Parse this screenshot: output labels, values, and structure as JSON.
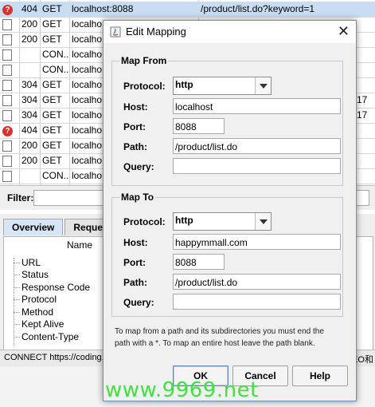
{
  "table": {
    "rows": [
      {
        "icon": "error-icon",
        "code": "404",
        "method": "GET",
        "host": "localhost:8088",
        "path": "/product/list.do?keyword=1",
        "extra": ""
      },
      {
        "icon": "document-icon",
        "code": "200",
        "method": "GET",
        "host": "localho",
        "path": "",
        "extra": ""
      },
      {
        "icon": "document-icon",
        "code": "200",
        "method": "GET",
        "host": "localho",
        "path": "",
        "extra": ""
      },
      {
        "icon": "document-icon",
        "code": "",
        "method": "CON...",
        "host": "localho",
        "path": "",
        "extra": ""
      },
      {
        "icon": "document-icon",
        "code": "",
        "method": "CON...",
        "host": "localho",
        "path": "",
        "extra": ""
      },
      {
        "icon": "document-stack-icon",
        "code": "304",
        "method": "GET",
        "host": "localho",
        "path": "",
        "extra": ""
      },
      {
        "icon": "document-stack-icon",
        "code": "304",
        "method": "GET",
        "host": "localho",
        "path": "",
        "extra": "17"
      },
      {
        "icon": "document-stack-icon",
        "code": "304",
        "method": "GET",
        "host": "localho",
        "path": "",
        "extra": "17"
      },
      {
        "icon": "error-icon",
        "code": "404",
        "method": "GET",
        "host": "localho",
        "path": "",
        "extra": ""
      },
      {
        "icon": "document-icon",
        "code": "200",
        "method": "GET",
        "host": "localho",
        "path": "",
        "extra": ""
      },
      {
        "icon": "document-icon",
        "code": "200",
        "method": "GET",
        "host": "localho",
        "path": "",
        "extra": ""
      },
      {
        "icon": "document-icon",
        "code": "",
        "method": "CON...",
        "host": "localho",
        "path": "",
        "extra": ""
      }
    ]
  },
  "filter": {
    "label": "Filter:"
  },
  "detail": {
    "tabs": [
      "Overview",
      "Request"
    ],
    "name_header": "Name",
    "items": [
      "URL",
      "Status",
      "Response Code",
      "Protocol",
      "Method",
      "Kept Alive",
      "Content-Type"
    ]
  },
  "status_bar": {
    "text": "CONNECT https://coding.im",
    "right_text": "EO和"
  },
  "dialog": {
    "title": "Edit Mapping",
    "map_from": {
      "title": "Map From",
      "protocol_label": "Protocol:",
      "protocol": "http",
      "host_label": "Host:",
      "host": "localhost",
      "port_label": "Port:",
      "port": "8088",
      "path_label": "Path:",
      "path": "/product/list.do",
      "query_label": "Query:",
      "query": ""
    },
    "map_to": {
      "title": "Map To",
      "protocol_label": "Protocol:",
      "protocol": "http",
      "host_label": "Host:",
      "host": "happymmall.com",
      "port_label": "Port:",
      "port": "8088",
      "path_label": "Path:",
      "path": "/product/list.do",
      "query_label": "Query:",
      "query": ""
    },
    "hint_line1": "To map from a path and its subdirectories you must end the",
    "hint_line2": "path with a *. To map an entire host leave the path blank.",
    "ok_label": "OK",
    "cancel_label": "Cancel",
    "help_label": "Help"
  },
  "watermark": "www.9969.net"
}
